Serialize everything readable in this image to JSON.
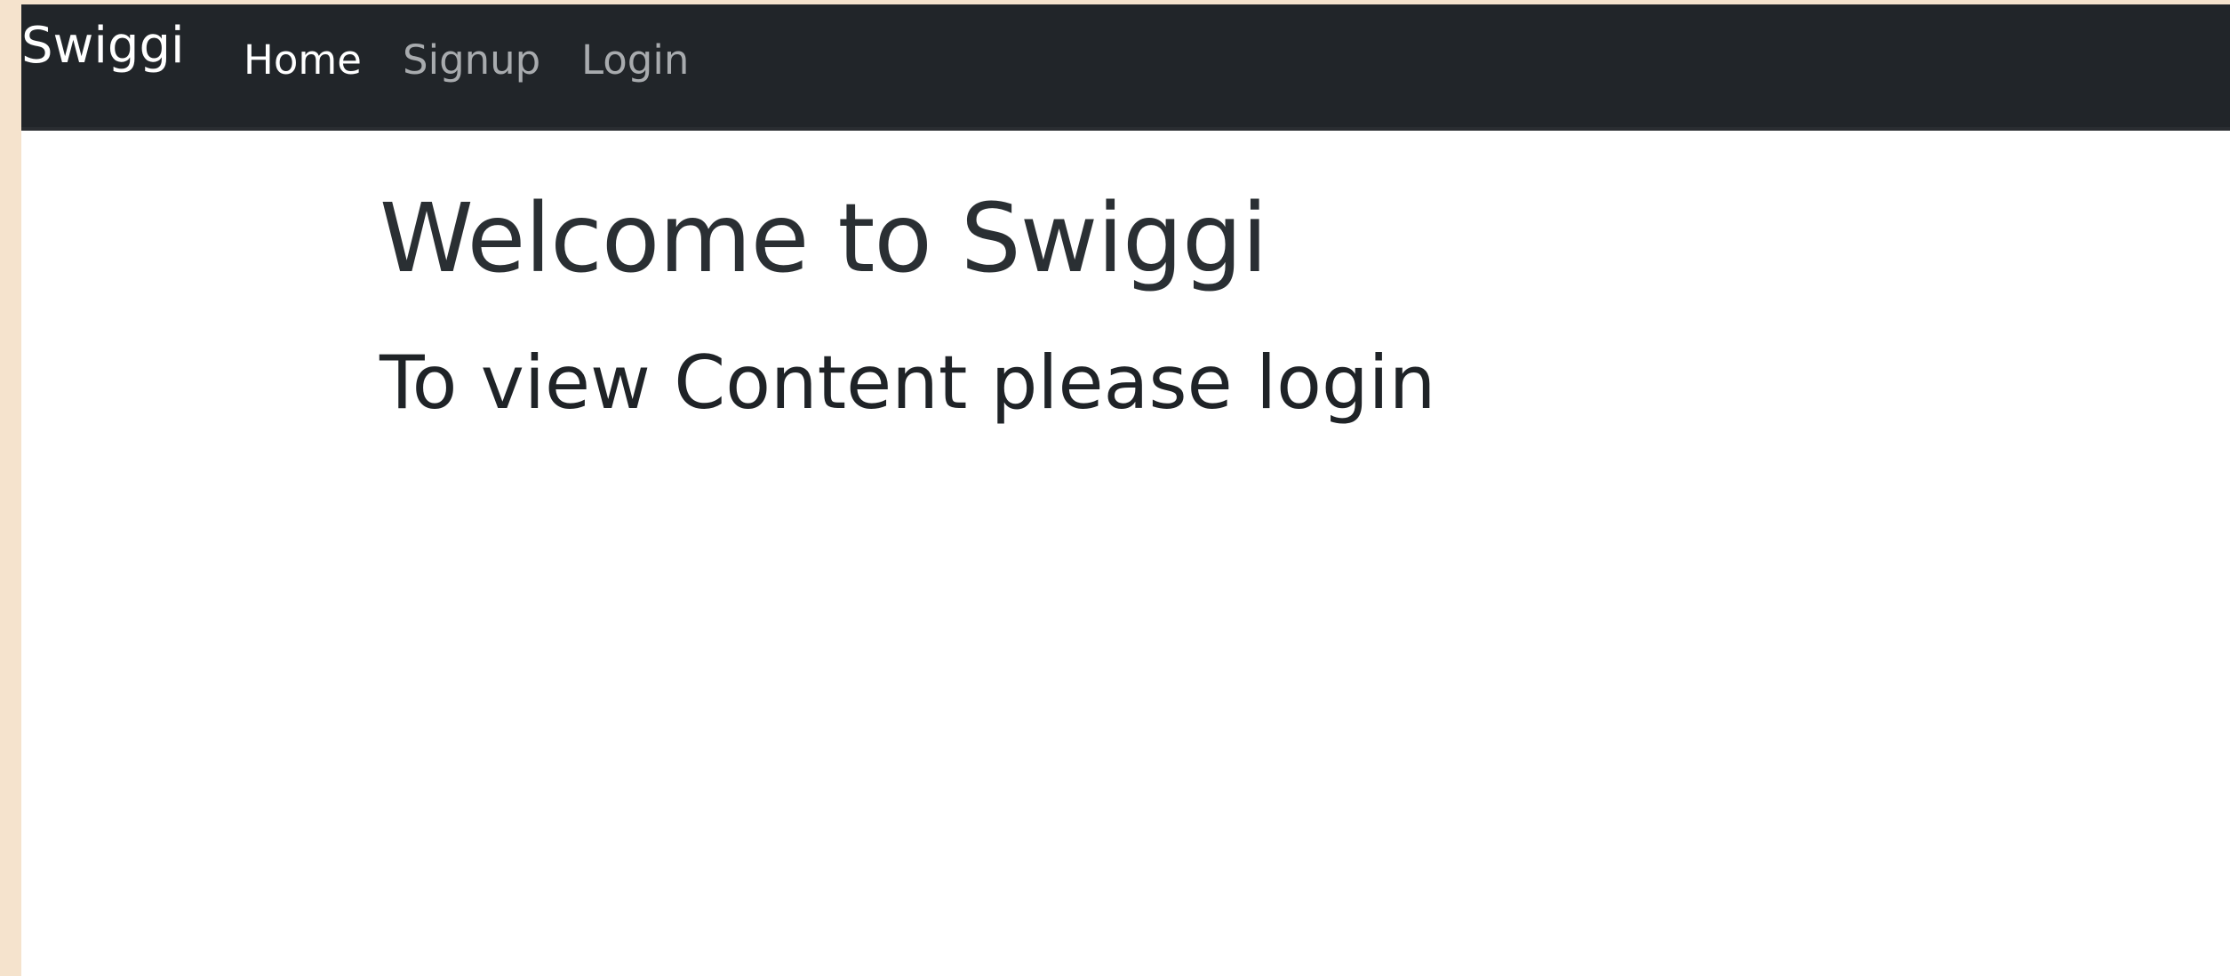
{
  "navbar": {
    "brand": "Swiggi",
    "links": [
      {
        "label": "Home",
        "active": true
      },
      {
        "label": "Signup",
        "active": false
      },
      {
        "label": "Login",
        "active": false
      }
    ]
  },
  "main": {
    "heading": "Welcome to Swiggi",
    "subheading": "To view Content please login"
  },
  "colors": {
    "navbar_bg": "#212529",
    "active_link": "#ffffff",
    "inactive_link": "#a8abae",
    "page_bg": "#ffffff",
    "outer_bg": "#f5e3cd",
    "text": "#212529"
  }
}
